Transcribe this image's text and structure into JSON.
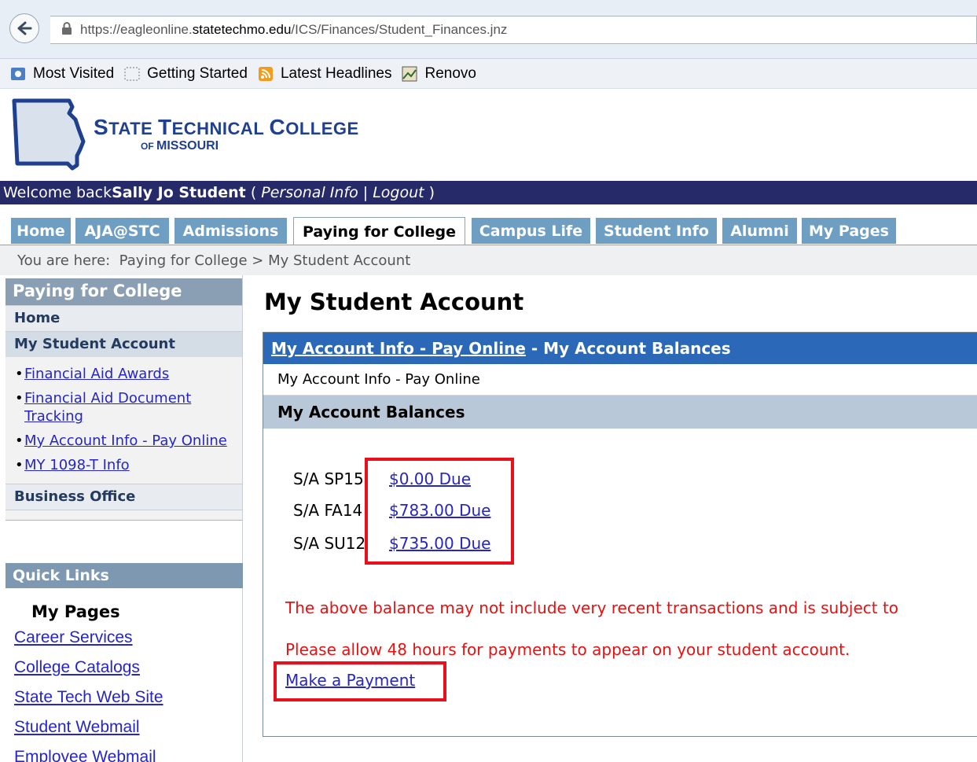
{
  "browser": {
    "url_prefix": "https://eagleonline.",
    "url_domain": "statetechmo.edu",
    "url_path": "/ICS/Finances/Student_Finances.jnz",
    "bookmarks": [
      {
        "label": "Most Visited",
        "icon": "most-visited-icon"
      },
      {
        "label": "Getting Started",
        "icon": "getting-started-icon"
      },
      {
        "label": "Latest Headlines",
        "icon": "rss-feed-icon"
      },
      {
        "label": "Renovo",
        "icon": "renovo-icon"
      }
    ]
  },
  "logo": {
    "line1_s": "S",
    "line1_tate": "TATE ",
    "line1_t": "T",
    "line1_echnical": "ECHNICAL ",
    "line1_c": "C",
    "line1_ollege": "OLLEGE",
    "line2_of": "OF ",
    "line2_state": "MISSOURI"
  },
  "welcome": {
    "prefix": "Welcome back ",
    "name": "Sally Jo Student",
    "open": " ( ",
    "personal_info": "Personal Info",
    "sep": " | ",
    "logout": "Logout",
    "close": " )"
  },
  "tabs": [
    "Home",
    "AJA@STC",
    "Admissions",
    "Paying for College",
    "Campus Life",
    "Student Info",
    "Alumni",
    "My Pages"
  ],
  "breadcrumb": "You are here:  Paying for College > My Student Account",
  "sidebar": {
    "heading": "Paying for College",
    "home": "Home",
    "my_student_account": "My Student Account",
    "sub_items": [
      "Financial Aid Awards",
      "Financial Aid Document Tracking",
      "My Account Info - Pay Online",
      "MY 1098-T Info"
    ],
    "business_office": "Business Office"
  },
  "quick_links": {
    "heading": "Quick Links",
    "my_pages": "My Pages",
    "links": [
      "Career Services",
      "College Catalogs",
      "State Tech Web Site",
      "Student Webmail",
      "Employee Webmail"
    ]
  },
  "main": {
    "title": "My Student Account",
    "portlet_link": "My Account Info - Pay Online",
    "portlet_rest": " - My Account Balances",
    "sub_label": "My Account Info - Pay Online",
    "balances_heading": "My Account Balances",
    "balances": [
      {
        "term": "S/A SP15",
        "amount": "$0.00 Due"
      },
      {
        "term": "S/A FA14",
        "amount": "$783.00 Due"
      },
      {
        "term": "S/A SU12",
        "amount": "$735.00 Due"
      }
    ],
    "notice1": "The above balance may not include very recent transactions and is subject to",
    "notice2": "Please allow 48 hours for payments to appear on your student account.",
    "pay_link": "Make a Payment"
  },
  "colors": {
    "welcome_bar": "#262a69",
    "tab": "#6f9ec3",
    "portlet_header": "#2c68b8",
    "notice_text": "#e81010",
    "highlight_box": "#e8101c"
  }
}
